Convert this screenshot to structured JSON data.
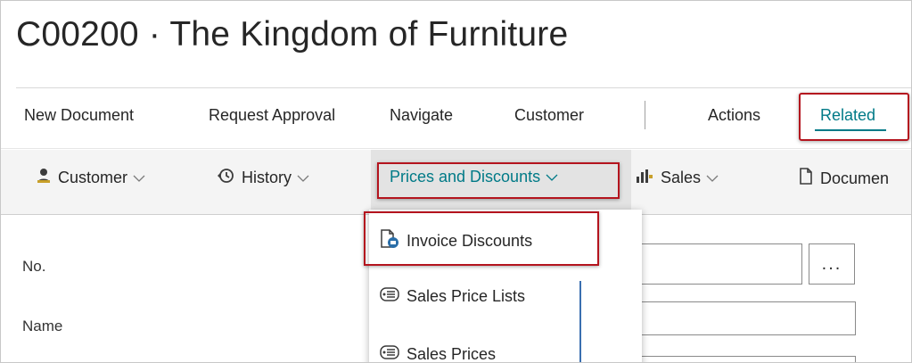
{
  "page": {
    "title": "C00200 · The Kingdom of Furniture"
  },
  "menu": {
    "items": [
      {
        "label": "New Document"
      },
      {
        "label": "Request Approval"
      },
      {
        "label": "Navigate"
      },
      {
        "label": "Customer"
      },
      {
        "label": "Actions"
      },
      {
        "label": "Related",
        "selected": true
      }
    ],
    "accent_color": "#007a87",
    "highlight_color": "#b4141e"
  },
  "toolbar": {
    "items": [
      {
        "label": "Customer",
        "icon": "person-icon"
      },
      {
        "label": "History",
        "icon": "history-icon"
      },
      {
        "label": "Prices and Discounts",
        "icon": "",
        "active": true
      },
      {
        "label": "Sales",
        "icon": "sales-chart-icon"
      },
      {
        "label": "Documen",
        "icon": "document-icon"
      }
    ]
  },
  "dropdown": {
    "items": [
      {
        "label": "Invoice Discounts",
        "icon": "invoice-discount-icon"
      },
      {
        "label": "Sales Price Lists",
        "icon": "price-list-icon"
      },
      {
        "label": "Sales Prices",
        "icon": "price-list-icon"
      }
    ]
  },
  "form": {
    "fields": [
      {
        "label": "No.",
        "value": ""
      },
      {
        "label": "Name",
        "value": ""
      }
    ],
    "ellipsis": "..."
  }
}
